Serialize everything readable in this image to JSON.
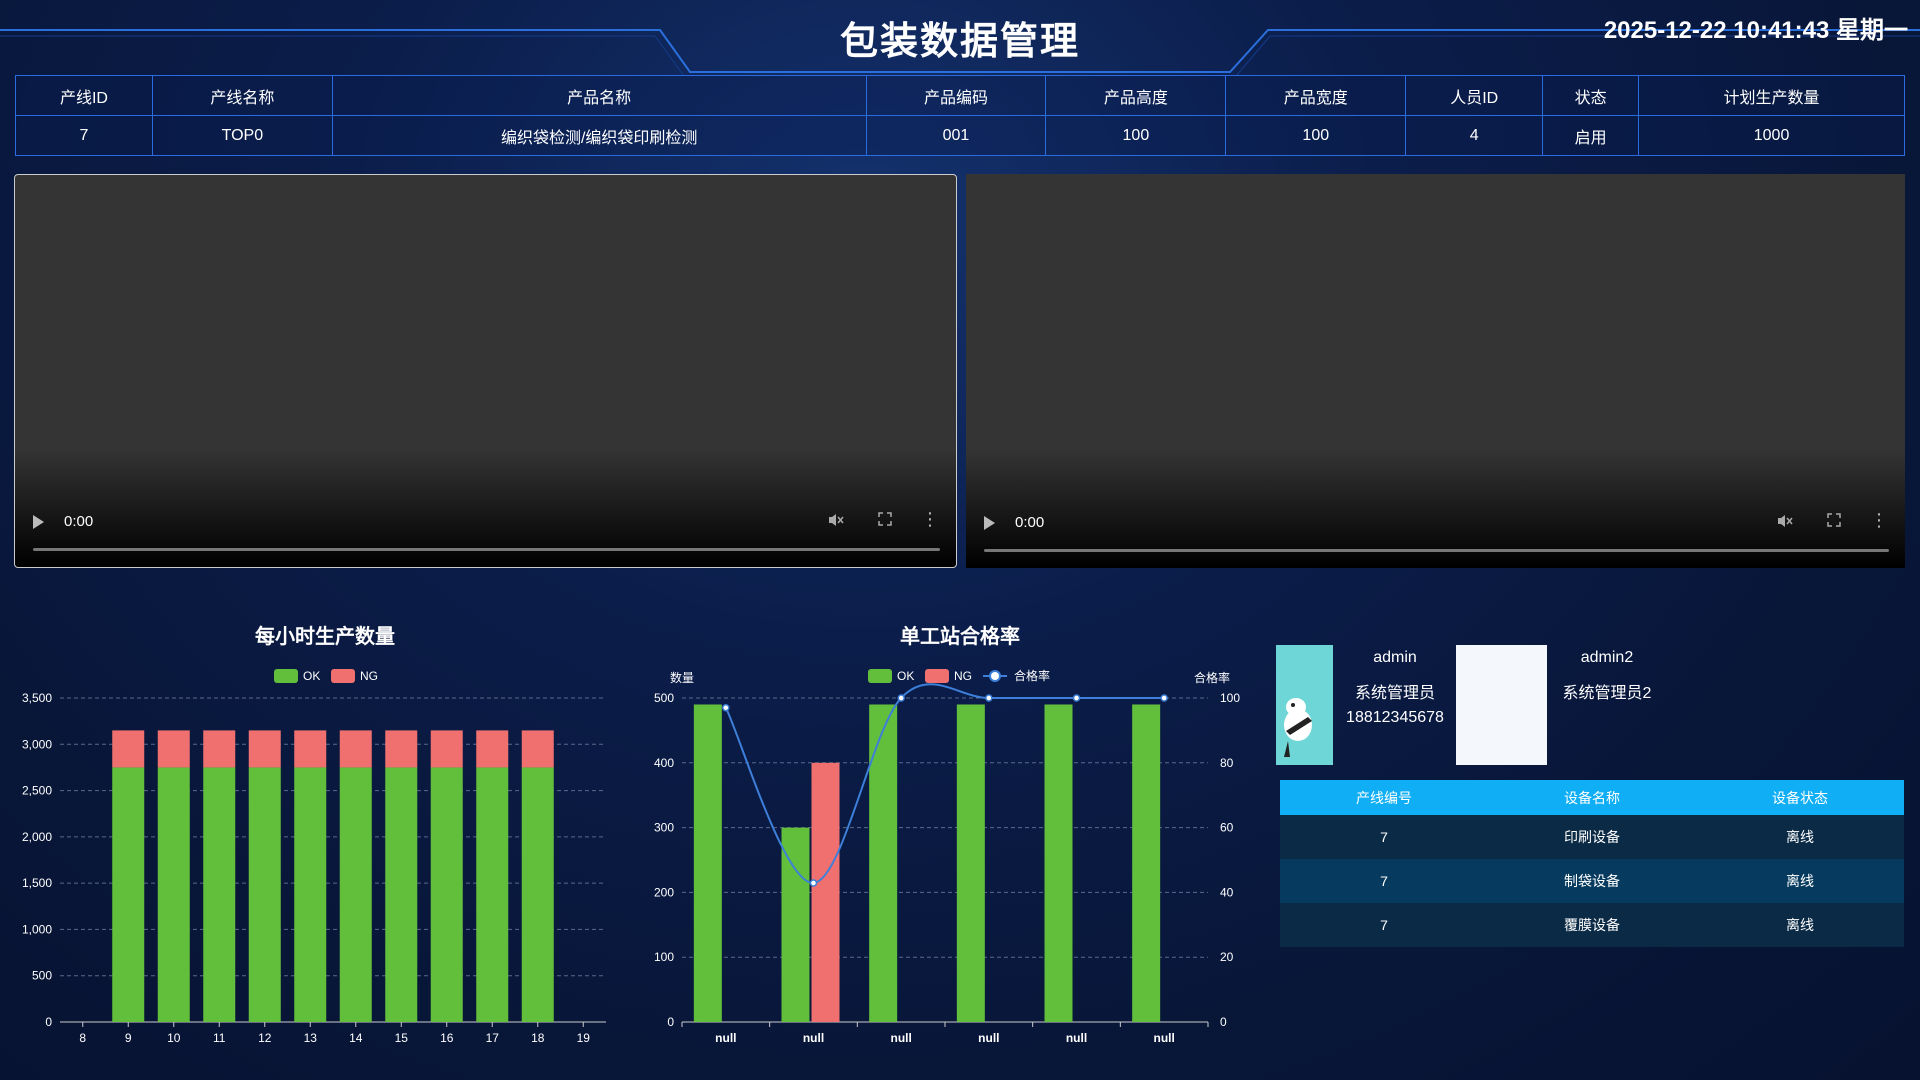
{
  "header": {
    "title": "包装数据管理",
    "datetime": "2025-12-22 10:41:43 星期一"
  },
  "product_table": {
    "columns": [
      "产线ID",
      "产线名称",
      "产品名称",
      "产品编码",
      "产品高度",
      "产品宽度",
      "人员ID",
      "状态",
      "计划生产数量"
    ],
    "row": [
      "7",
      "TOP0",
      "编织袋检测/编织袋印刷检测",
      "001",
      "100",
      "100",
      "4",
      "启用",
      "1000"
    ]
  },
  "videos": [
    {
      "time": "0:00"
    },
    {
      "time": "0:00"
    }
  ],
  "chart_data": [
    {
      "type": "bar",
      "stacked": true,
      "title": "每小时生产数量",
      "legend": [
        "OK",
        "NG"
      ],
      "legend_position": "top-center",
      "categories": [
        "8",
        "9",
        "10",
        "11",
        "12",
        "13",
        "14",
        "15",
        "16",
        "17",
        "18",
        "19"
      ],
      "series": [
        {
          "name": "OK",
          "color": "#62bf3c",
          "values": [
            null,
            2750,
            2750,
            2750,
            2750,
            2750,
            2750,
            2750,
            2750,
            2750,
            2750,
            null
          ]
        },
        {
          "name": "NG",
          "color": "#f07070",
          "values": [
            null,
            400,
            400,
            400,
            400,
            400,
            400,
            400,
            400,
            400,
            400,
            null
          ]
        }
      ],
      "ylim": [
        0,
        3500
      ],
      "yticks": [
        "0",
        "500",
        "1,000",
        "1,500",
        "2,000",
        "2,500",
        "3,000",
        "3,500"
      ],
      "grid": true
    },
    {
      "type": "bar",
      "title": "单工站合格率",
      "legend": [
        "OK",
        "NG",
        "合格率"
      ],
      "legend_position": "top-center",
      "ylabel": "数量",
      "y2label": "合格率",
      "categories": [
        "null",
        "null",
        "null",
        "null",
        "null",
        "null"
      ],
      "series": [
        {
          "name": "OK",
          "color": "#62bf3c",
          "values": [
            490,
            300,
            490,
            490,
            490,
            490
          ]
        },
        {
          "name": "NG",
          "color": "#f07070",
          "values": [
            null,
            400,
            null,
            null,
            null,
            null
          ]
        },
        {
          "name": "合格率",
          "type": "line",
          "axis": "right",
          "color": "#3d7fd9",
          "values": [
            97,
            42.9,
            100,
            100,
            100,
            100
          ]
        }
      ],
      "ylim": [
        0,
        500
      ],
      "yticks": [
        "0",
        "100",
        "200",
        "300",
        "400",
        "500"
      ],
      "y2lim": [
        0,
        100
      ],
      "y2ticks": [
        "0",
        "20",
        "40",
        "60",
        "80",
        "100"
      ],
      "grid": true
    }
  ],
  "users": [
    {
      "name": "admin",
      "role": "系统管理员",
      "phone": "18812345678",
      "avatar": "cartoon-avatar"
    },
    {
      "name": "admin2",
      "role": "系统管理员2",
      "phone": "",
      "avatar": "blank-avatar"
    }
  ],
  "device_table": {
    "columns": [
      "产线编号",
      "设备名称",
      "设备状态"
    ],
    "rows": [
      [
        "7",
        "印刷设备",
        "离线"
      ],
      [
        "7",
        "制袋设备",
        "离线"
      ],
      [
        "7",
        "覆膜设备",
        "离线"
      ]
    ]
  }
}
